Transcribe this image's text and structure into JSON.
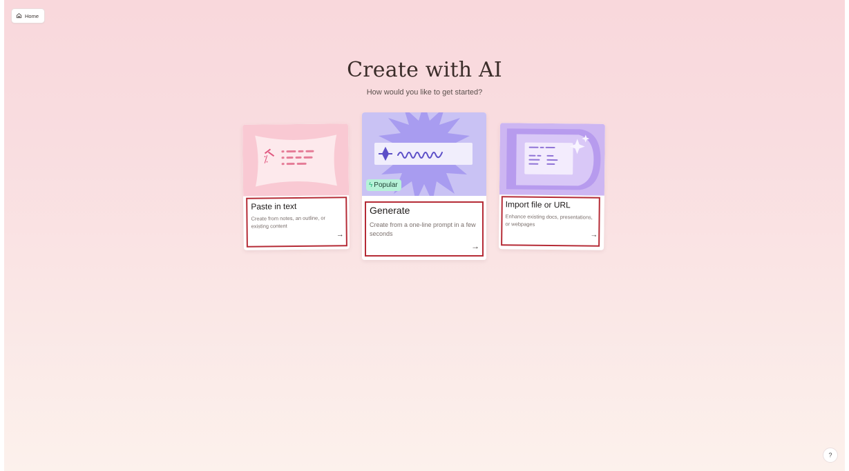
{
  "nav": {
    "home_label": "Home"
  },
  "header": {
    "title": "Create with AI",
    "subtitle": "How would you like to get started?"
  },
  "cards": [
    {
      "title": "Paste in text",
      "description": "Create from notes, an outline, or existing content",
      "arrow": "→",
      "illustration_color": "#f9c9d3"
    },
    {
      "title": "Generate",
      "description": "Create from a one-line prompt in a few seconds",
      "arrow": "→",
      "badge": "Popular",
      "badge_icon": "bolt-icon",
      "illustration_color": "#c9c2f4"
    },
    {
      "title": "Import file or URL",
      "description": "Enhance existing docs, presentations, or webpages",
      "arrow": "→",
      "illustration_color": "#cdb6f2"
    }
  ],
  "help": {
    "label": "?"
  },
  "colors": {
    "highlight_outline": "#b52a35",
    "popular_badge": "#b6f2d8",
    "background_top": "#f9d8dc",
    "background_bottom": "#fcf1ec"
  }
}
